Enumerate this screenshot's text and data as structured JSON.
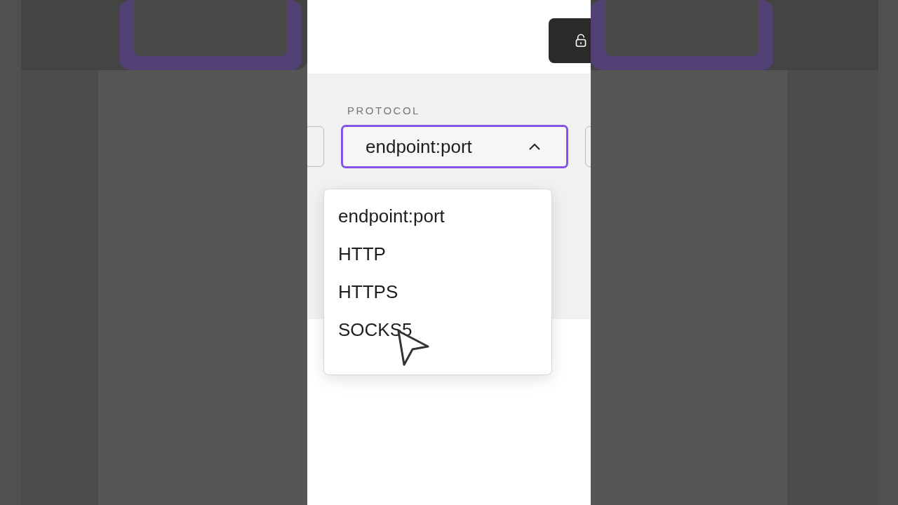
{
  "protocol": {
    "label": "PROTOCOL",
    "value": "endpoint:port",
    "expanded": true,
    "options": [
      "endpoint:port",
      "HTTP",
      "HTTPS",
      "SOCKS5"
    ]
  }
}
